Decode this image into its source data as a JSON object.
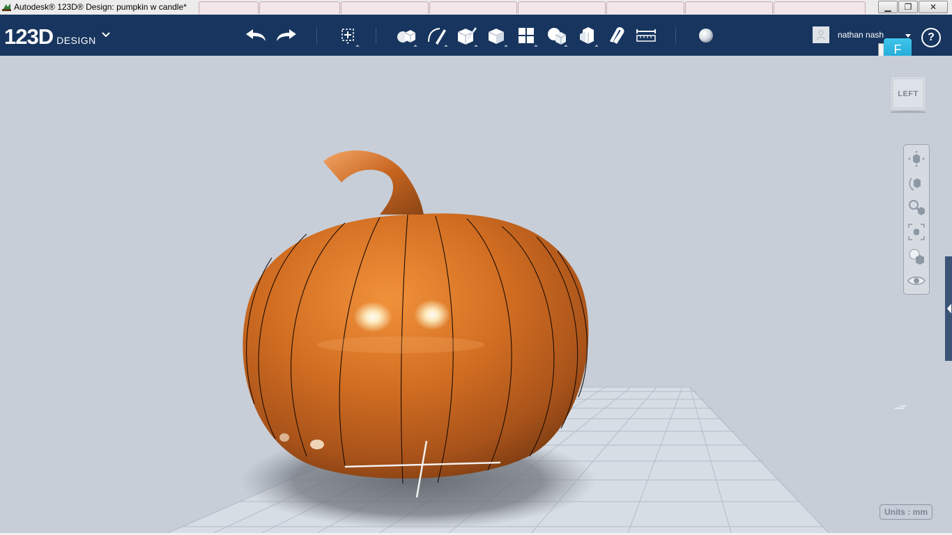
{
  "window": {
    "title": "Autodesk® 123D® Design: pumpkin w candle*",
    "min_label": "▁",
    "max_label": "❐",
    "close_label": "✕"
  },
  "app": {
    "logo_num": "123D",
    "logo_word": "DESIGN"
  },
  "toolbar": {
    "tools": [
      "undo-icon",
      "redo-icon",
      "transform-icon",
      "primitives-icon",
      "sketch-icon",
      "construct-icon",
      "modify-icon",
      "pattern-icon",
      "grouping-icon",
      "combine-icon",
      "snap-icon",
      "measure-icon",
      "material-icon"
    ]
  },
  "user": {
    "name": "nathan nash",
    "help_label": "?"
  },
  "badge": {
    "label": "F"
  },
  "viewcube": {
    "label": "LEFT"
  },
  "navbar": {
    "items": [
      "pan-icon",
      "orbit-icon",
      "zoom-icon",
      "fit-icon",
      "visual-style-icon",
      "visibility-icon"
    ]
  },
  "status": {
    "units": "Units : mm"
  },
  "colors": {
    "toolbar_bg": "#17355e",
    "viewport_bg": "#c7ced8",
    "pumpkin": "#c8661e",
    "badge": "#2bb5e0"
  }
}
